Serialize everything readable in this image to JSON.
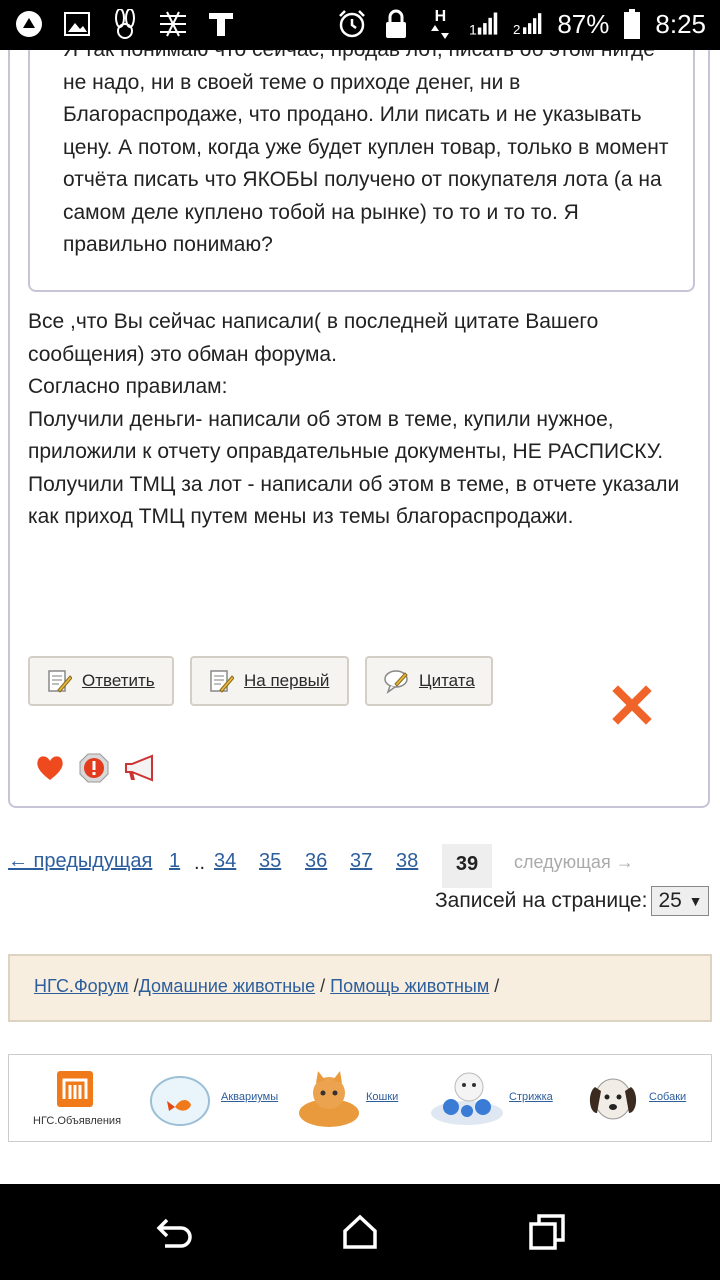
{
  "status_bar": {
    "battery": "87%",
    "time": "8:25",
    "icons": [
      "android-icon",
      "image-icon",
      "bunny-icon",
      "app-icon",
      "text-icon",
      "alarm-icon",
      "lock-icon",
      "data-arrows-icon",
      "signal-1-icon",
      "signal-2-icon",
      "battery-icon"
    ],
    "network_label": "H"
  },
  "post": {
    "quote_text": "Я так понимаю что сейчас, продав лот, писать об этом нигде не надо, ни в своей теме о приходе денег, ни в Благораспродаже, что продано. Или писать и не указывать цену. А потом, когда уже будет куплен товар, только в момент отчёта писать что ЯКОБЫ получено от покупателя лота (а на самом деле куплено тобой на рынке) то то и то то. Я правильно понимаю?",
    "reply_lines": [
      "Все ,что Вы сейчас написали( в последней цитате Вашего сообщения) это обман форума.",
      "Согласно правилам:",
      "Получили деньги- написали об этом в теме, купили нужное, приложили к отчету оправдательные документы, НЕ РАСПИСКУ.",
      "Получили ТМЦ за лот - написали об этом в теме, в отчете указали как приход ТМЦ путем мены из темы благораспродажи."
    ],
    "buttons": {
      "reply": "Ответить",
      "to_first": "На первый",
      "quote": "Цитата"
    }
  },
  "pagination": {
    "prev": "← предыдущая",
    "first": "1",
    "ellipsis": "..",
    "pages": [
      "34",
      "35",
      "36",
      "37",
      "38"
    ],
    "current": "39",
    "next": "следующая →",
    "per_page_label": "Записей на странице:",
    "per_page_value": "25"
  },
  "breadcrumb": {
    "items": [
      "НГС.Форум",
      "Домашние животные",
      "Помощь животным"
    ],
    "sep": "/"
  },
  "banner": {
    "logo_label": "НГС.Объявления",
    "links": [
      "Аквариумы",
      "Кошки",
      "Стрижка",
      "Собаки"
    ]
  },
  "colors": {
    "link": "#2d5e9c",
    "border": "#c9c3d8",
    "breadcrumb_bg": "#f8eedf",
    "close_x": "#f0642a"
  }
}
